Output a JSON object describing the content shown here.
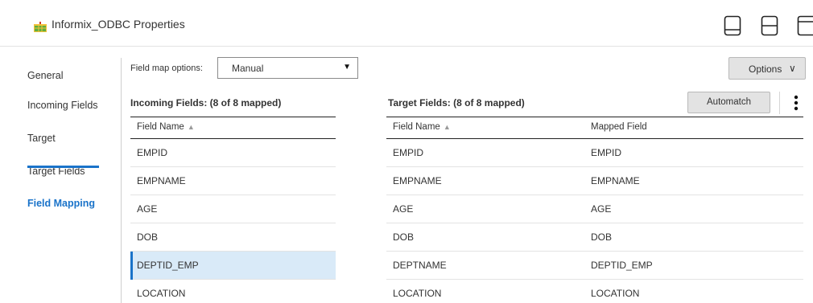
{
  "header": {
    "title": "Informix_ODBC Properties",
    "icon": "informix-table-icon",
    "view_buttons": [
      "dock-bottom-icon",
      "split-horizontal-icon",
      "dock-right-icon"
    ]
  },
  "nav": {
    "items": [
      {
        "label": "General",
        "active": false
      },
      {
        "label": "Incoming Fields",
        "active": false
      },
      {
        "label": "Target",
        "active": false
      },
      {
        "label": "Target Fields",
        "active": false
      },
      {
        "label": "Field Mapping",
        "active": true
      }
    ],
    "active_color": "#1a73c9"
  },
  "field_map": {
    "label": "Field map options:",
    "value": "Manual",
    "caret": "▼"
  },
  "options_button": {
    "label": "Options",
    "chevron": "∨"
  },
  "incoming": {
    "title": "Incoming Fields: (8 of 8 mapped)",
    "column": "Field Name",
    "sort": "▲",
    "rows": [
      "EMPID",
      "EMPNAME",
      "AGE",
      "DOB",
      "DEPTID_EMP",
      "LOCATION"
    ],
    "selected_index": 4
  },
  "target": {
    "title": "Target Fields: (8 of 8 mapped)",
    "column_name": "Field Name",
    "column_mapped": "Mapped Field",
    "sort": "▲",
    "rows": [
      {
        "name": "EMPID",
        "mapped": "EMPID"
      },
      {
        "name": "EMPNAME",
        "mapped": "EMPNAME"
      },
      {
        "name": "AGE",
        "mapped": "AGE"
      },
      {
        "name": "DOB",
        "mapped": "DOB"
      },
      {
        "name": "DEPTNAME",
        "mapped": "DEPTID_EMP"
      },
      {
        "name": "LOCATION",
        "mapped": "LOCATION"
      }
    ]
  },
  "automatch_button": {
    "label": "Automatch"
  },
  "kebab_icon": "more-vertical-icon"
}
